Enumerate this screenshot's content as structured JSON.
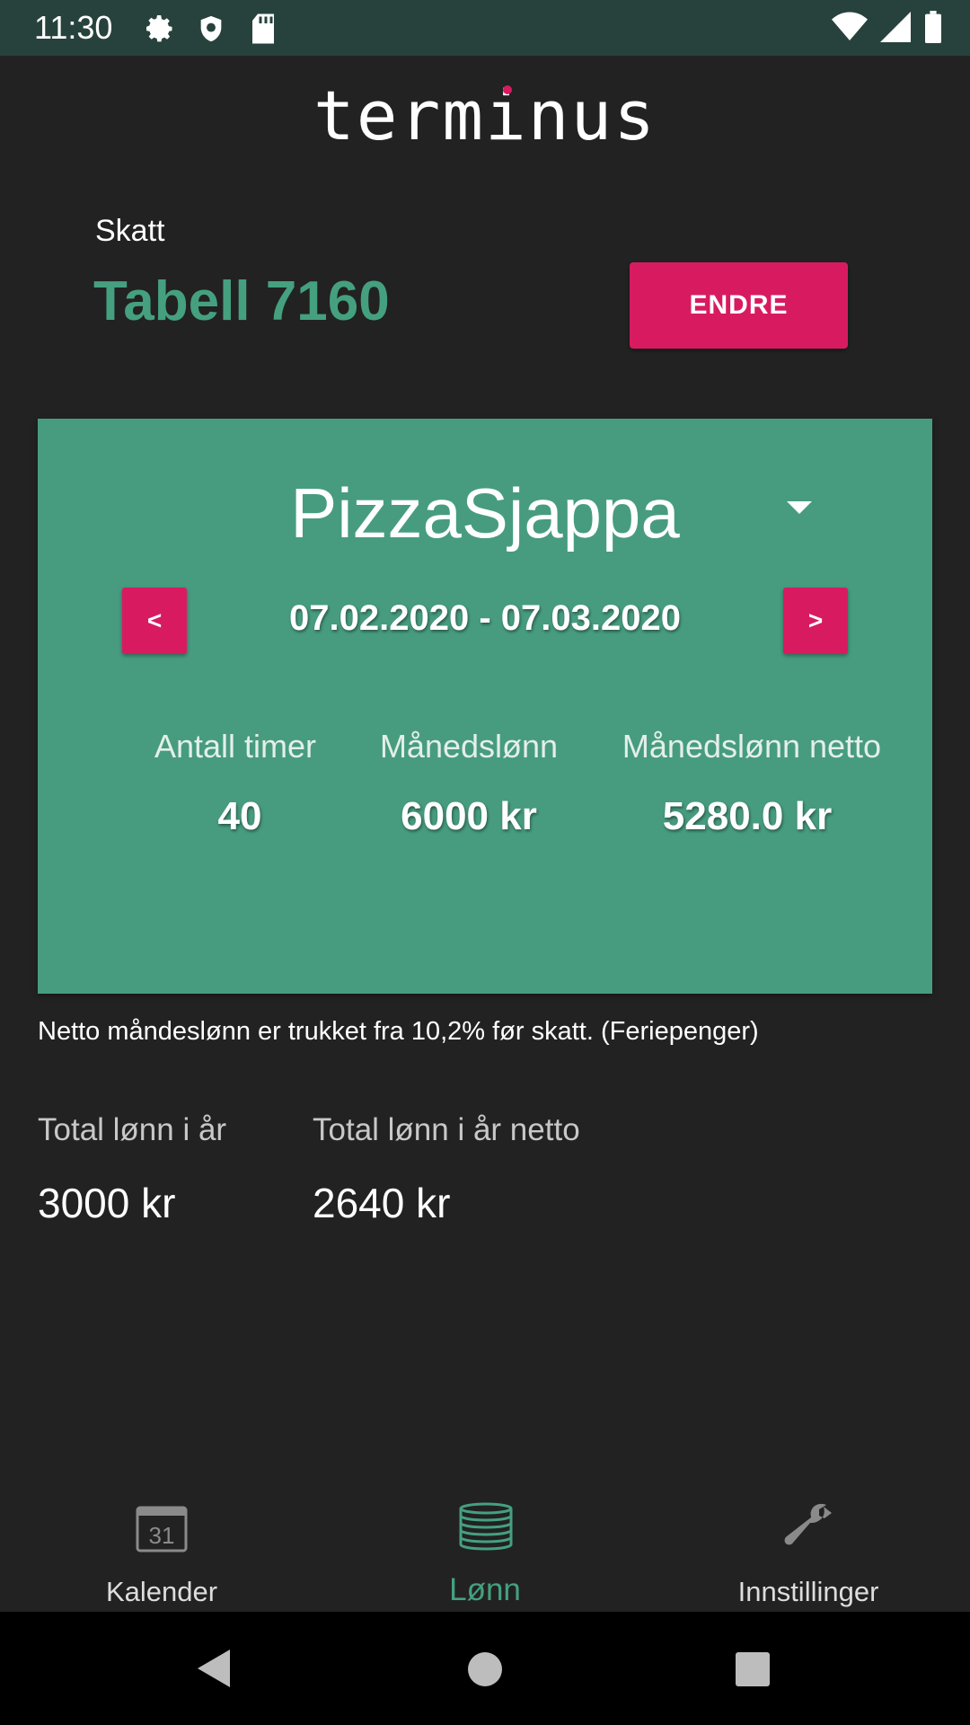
{
  "status_bar": {
    "time": "11:30",
    "left_icons": [
      "gear-icon",
      "shield-icon",
      "sd-card-icon"
    ],
    "right_icons": [
      "wifi-icon",
      "signal-icon",
      "battery-icon"
    ]
  },
  "app": {
    "logo": "terminus"
  },
  "tax": {
    "label": "Skatt",
    "value": "Tabell 7160",
    "button_label": "ENDRE"
  },
  "card": {
    "employer": "PizzaSjappa",
    "prev_label": "<",
    "next_label": ">",
    "period": "07.02.2020 - 07.03.2020",
    "stats": [
      {
        "label": "Antall timer",
        "value": "40"
      },
      {
        "label": "Månedslønn",
        "value": "6000 kr"
      },
      {
        "label": "Månedslønn netto",
        "value": "5280.0 kr"
      }
    ]
  },
  "note": "Netto måndeslønn er trukket fra 10,2% før skatt. (Feriepenger)",
  "totals": [
    {
      "label": "Total lønn i år",
      "value": "3000 kr"
    },
    {
      "label": "Total lønn i år netto",
      "value": "2640 kr"
    }
  ],
  "bottom_nav": {
    "items": [
      {
        "label": "Kalender",
        "icon": "calendar-icon",
        "icon_text": "31"
      },
      {
        "label": "Lønn",
        "icon": "coins-icon",
        "active": true
      },
      {
        "label": "Innstillinger",
        "icon": "wrench-icon"
      }
    ]
  },
  "colors": {
    "accent": "#d81b60",
    "primary": "#45a080",
    "card": "#479c80",
    "background": "#222222",
    "status_bar": "#27423c"
  }
}
